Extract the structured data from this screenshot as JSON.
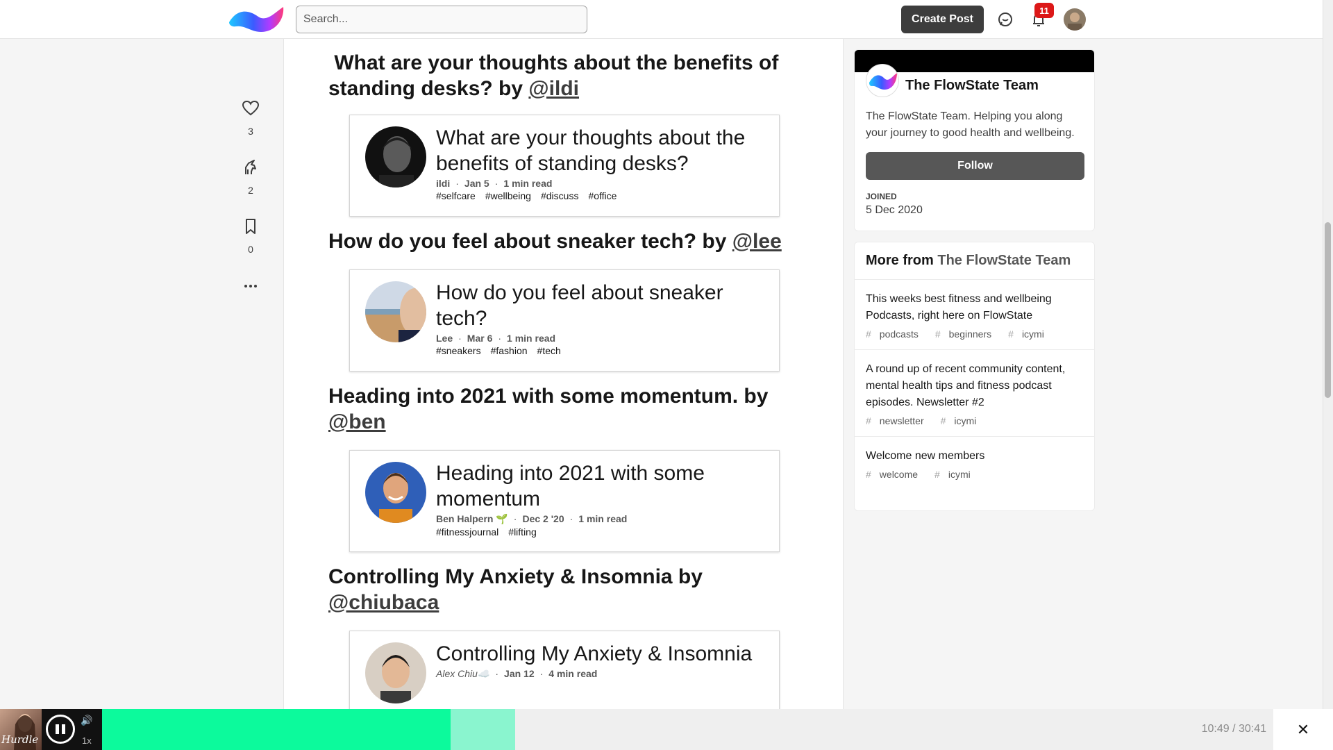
{
  "header": {
    "search_placeholder": "Search...",
    "create_post_label": "Create Post",
    "notifications_count": "11"
  },
  "reactions": [
    {
      "icon": "heart-icon",
      "count": "3"
    },
    {
      "icon": "unicorn-icon",
      "count": "2"
    },
    {
      "icon": "bookmark-icon",
      "count": "0"
    }
  ],
  "entries": [
    {
      "heading_prefix": "What are your thoughts about the benefits of standing desks? by",
      "heading_author": "@ildi",
      "card_title": "What are your thoughts about the benefits of standing desks?",
      "author": "ildi",
      "date": "Jan 5",
      "read_time": "1 min read",
      "tags": [
        "#selfcare",
        "#wellbeing",
        "#discuss",
        "#office"
      ]
    },
    {
      "heading_prefix": "How do you feel about sneaker tech? by",
      "heading_author": "@lee",
      "card_title": "How do you feel about sneaker tech?",
      "author": "Lee",
      "date": "Mar 6",
      "read_time": "1 min read",
      "tags": [
        "#sneakers",
        "#fashion",
        "#tech"
      ]
    },
    {
      "heading_prefix": "Heading into 2021 with some momentum. by",
      "heading_author": "@ben",
      "card_title": "Heading into 2021 with some momentum",
      "author": "Ben Halpern 🌱",
      "date": "Dec 2 '20",
      "read_time": "1 min read",
      "tags": [
        "#fitnessjournal",
        "#lifting"
      ]
    },
    {
      "heading_prefix": "Controlling My Anxiety & Insomnia by",
      "heading_author": "@chiubaca",
      "card_title": "Controlling My Anxiety & Insomnia",
      "author": "Alex Chiu☁️",
      "date": "Jan 12",
      "read_time": "4 min read",
      "tags": []
    }
  ],
  "profile": {
    "name": "The FlowState Team",
    "description": "The FlowState Team. Helping you along your journey to good health and wellbeing.",
    "follow_label": "Follow",
    "joined_label": "JOINED",
    "joined_date": "5 Dec 2020"
  },
  "more_from": {
    "prefix": "More from",
    "link": "The FlowState Team",
    "items": [
      {
        "title": "This weeks best fitness and wellbeing Podcasts, right here on FlowState",
        "tags": [
          "podcasts",
          "beginners",
          "icymi"
        ]
      },
      {
        "title": "A round up of recent community content, mental health tips and fitness podcast episodes. Newsletter #2",
        "tags": [
          "newsletter",
          "icymi"
        ]
      },
      {
        "title": "Welcome new members",
        "tags": [
          "welcome",
          "icymi"
        ]
      }
    ]
  },
  "player": {
    "cover_text": "Hurdle",
    "speed": "1x",
    "time": "10:49 / 30:41",
    "played_fraction": 0.298,
    "buffered_fraction": 0.353
  },
  "colors": {
    "accent_dark": "#3d3d3d",
    "badge_red": "#dc1818",
    "player_played": "#0cfa9c",
    "player_buffered": "#8af5cf"
  }
}
